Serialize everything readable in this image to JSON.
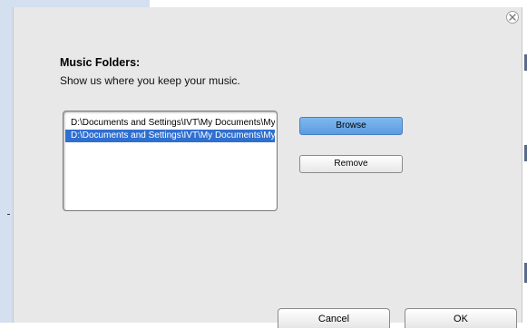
{
  "dialog": {
    "title_heading": "Music Folders:",
    "subtitle": "Show us where you keep your music."
  },
  "folders": {
    "items": [
      {
        "label": "D:\\Documents and Settings\\IVT\\My Documents\\My Music",
        "selected": false
      },
      {
        "label": "D:\\Documents and Settings\\IVT\\My Documents\\My Music",
        "selected": true
      }
    ]
  },
  "buttons": {
    "browse": "Browse",
    "remove": "Remove",
    "cancel": "Cancel",
    "ok": "OK"
  },
  "icons": {
    "close": "close-icon"
  },
  "colors": {
    "selection": "#2f6fd0",
    "primary_button": "#6aa8e8",
    "dialog_background": "#e8e8e8"
  }
}
